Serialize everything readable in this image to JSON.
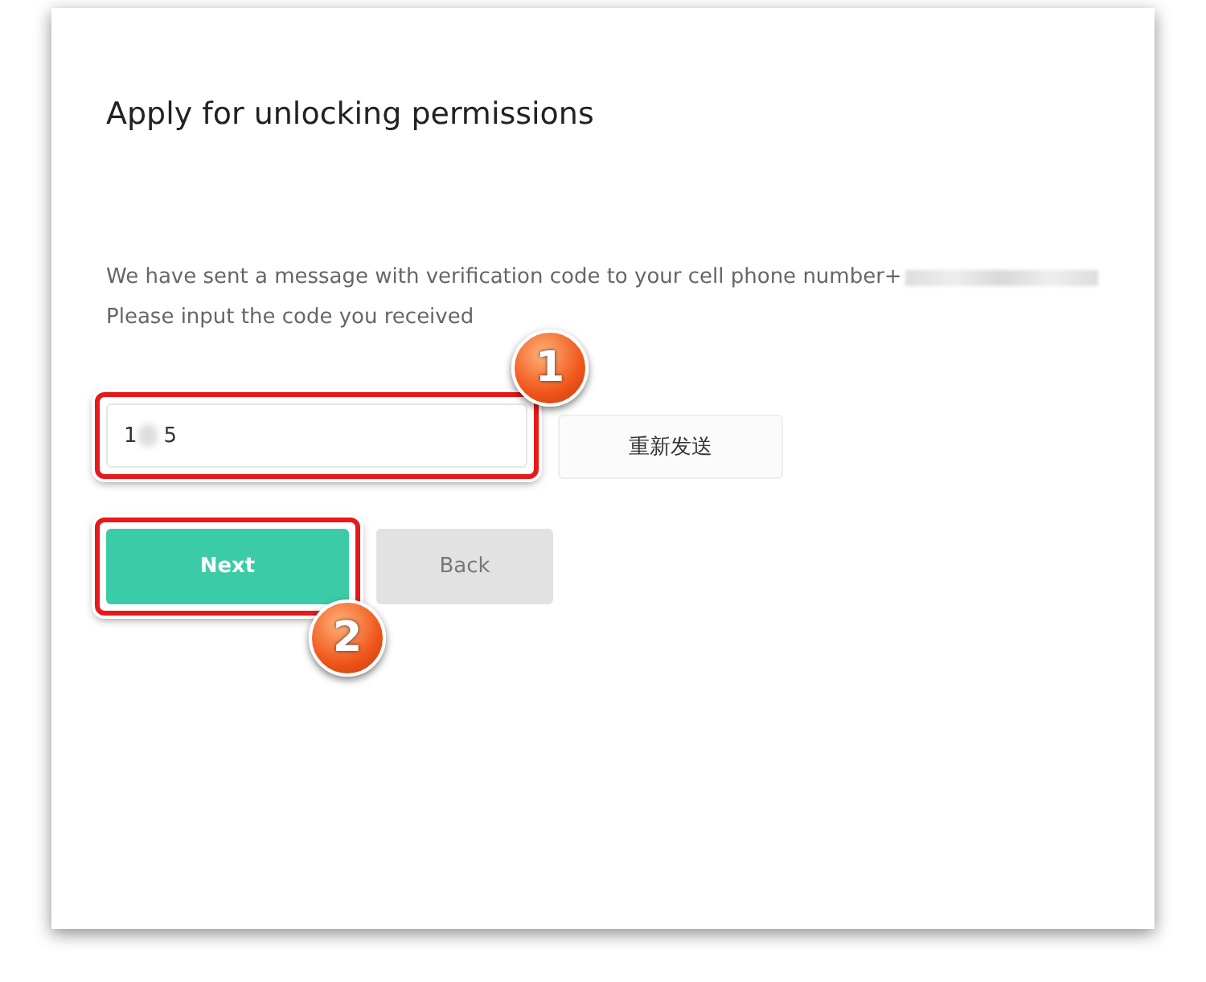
{
  "title": "Apply for unlocking permissions",
  "message": {
    "line_1": "We have sent a message with verification code to your cell phone number+",
    "line_2": "Please input the code you received"
  },
  "code_field": {
    "value": "1    5"
  },
  "resend_button": "重新发送",
  "next_button": "Next",
  "back_button": "Back",
  "callouts": [
    {
      "number": "1"
    },
    {
      "number": "2"
    }
  ]
}
